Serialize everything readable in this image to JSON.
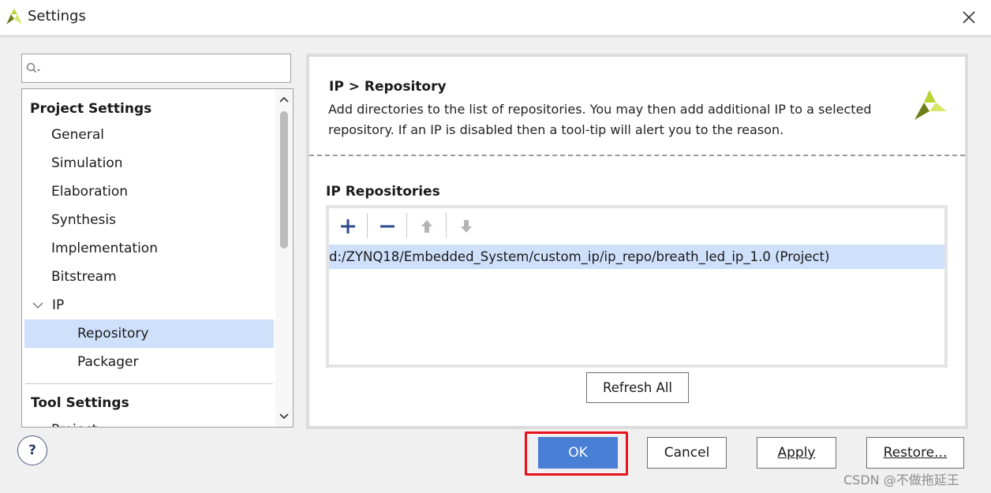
{
  "window": {
    "title": "Settings"
  },
  "search": {
    "value": "",
    "placeholder": ""
  },
  "tree": {
    "items": [
      {
        "label": "Project Settings"
      },
      {
        "label": "General"
      },
      {
        "label": "Simulation"
      },
      {
        "label": "Elaboration"
      },
      {
        "label": "Synthesis"
      },
      {
        "label": "Implementation"
      },
      {
        "label": "Bitstream"
      },
      {
        "label": "IP"
      },
      {
        "label": "Repository"
      },
      {
        "label": "Packager"
      },
      {
        "label": "Tool Settings"
      },
      {
        "label": "Project"
      }
    ],
    "selected": "Repository"
  },
  "panel": {
    "title": "IP > Repository",
    "description_line1": "Add directories to the list of repositories. You may then add additional IP to a selected",
    "description_line2": "repository. If an IP is disabled then a tool-tip will alert you to the reason.",
    "repos_label": "IP Repositories",
    "repos": [
      {
        "path": "d:/ZYNQ18/Embedded_System/custom_ip/ip_repo/breath_led_ip_1.0 (Project)"
      }
    ],
    "refresh_label": "Refresh All"
  },
  "footer": {
    "help_label": "?",
    "ok_label": "OK",
    "cancel_label": "Cancel",
    "apply_label": "Apply",
    "restore_label": "Restore...",
    "watermark": "CSDN @不做拖延王"
  },
  "colors": {
    "selection": "#cfe0fb",
    "ok_button": "#4a7fd6",
    "highlight_box": "#e8121b",
    "logo_green": "#8cbf26"
  }
}
